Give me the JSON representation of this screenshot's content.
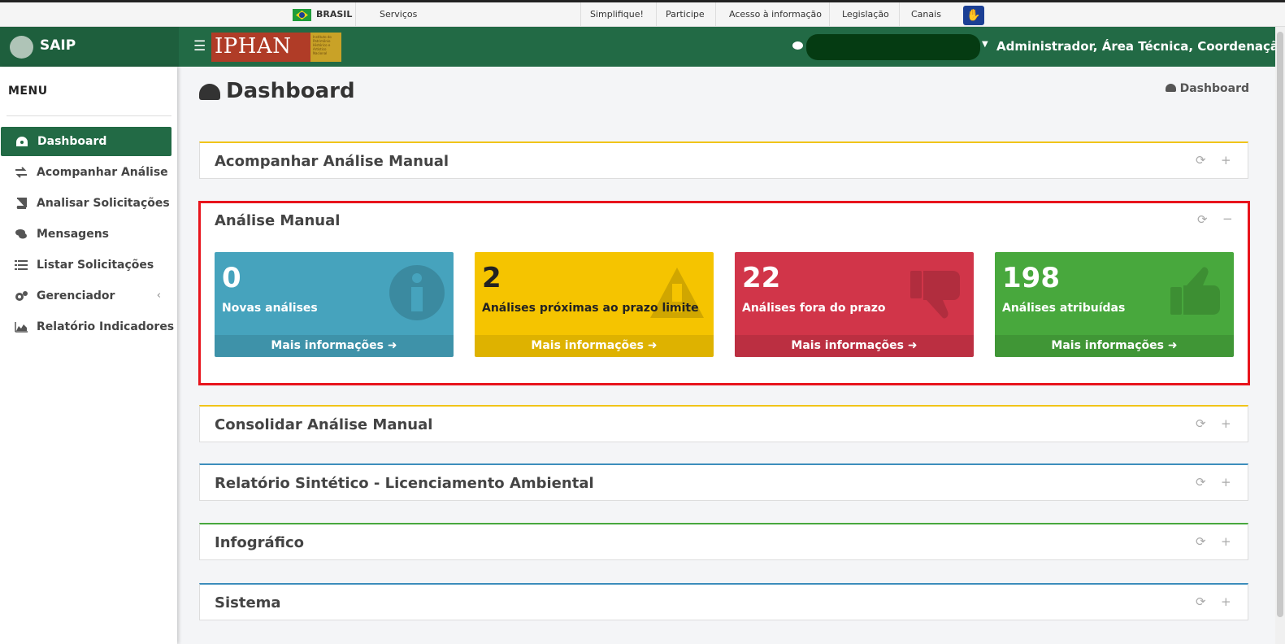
{
  "gov_bar": {
    "country": "BRASIL",
    "links": [
      "Serviços",
      "Simplifique!",
      "Participe",
      "Acesso à informação",
      "Legislação",
      "Canais"
    ]
  },
  "header": {
    "brand": "SAIP",
    "org_logo_text": "IPHAN",
    "org_logo_subtitle": "Instituto do Patrimônio Histórico e Artístico Nacional",
    "user_roles": "Administrador, Área Técnica, Coordenação..."
  },
  "sidebar": {
    "title": "MENU",
    "items": [
      {
        "label": "Dashboard",
        "icon": "dashboard-icon",
        "active": true
      },
      {
        "label": "Acompanhar Análise",
        "icon": "exchange-icon"
      },
      {
        "label": "Analisar Solicitações",
        "icon": "book-icon"
      },
      {
        "label": "Mensagens",
        "icon": "comments-icon"
      },
      {
        "label": "Listar Solicitações",
        "icon": "list-icon"
      },
      {
        "label": "Gerenciador",
        "icon": "gears-icon",
        "has_submenu": true
      },
      {
        "label": "Relatório Indicadores",
        "icon": "area-chart-icon"
      }
    ]
  },
  "page": {
    "title": "Dashboard",
    "breadcrumb": "Dashboard"
  },
  "boxes": [
    {
      "title": "Acompanhar Análise Manual",
      "accent": "#f0c419"
    },
    {
      "title": "Análise Manual"
    },
    {
      "title": "Consolidar Análise Manual",
      "accent": "#f0c419"
    },
    {
      "title": "Relatório Sintético - Licenciamento Ambiental",
      "accent": "#3c8dbc"
    },
    {
      "title": "Infográfico",
      "accent": "#48a83d"
    },
    {
      "title": "Sistema",
      "accent": "#3c8dbc"
    }
  ],
  "tiles": [
    {
      "value": "0",
      "label": "Novas análises",
      "footer": "Mais informações ➜",
      "color": "#46a3bd",
      "icon": "info-icon"
    },
    {
      "value": "2",
      "label": "Análises próximas ao prazo limite",
      "footer": "Mais informações ➜",
      "color": "#f5c400",
      "icon": "warning-icon"
    },
    {
      "value": "22",
      "label": "Análises fora do prazo",
      "footer": "Mais informações ➜",
      "color": "#d13549",
      "icon": "thumbs-down-icon"
    },
    {
      "value": "198",
      "label": "Análises atribuídas",
      "footer": "Mais informações ➜",
      "color": "#48a83d",
      "icon": "thumbs-up-icon"
    }
  ],
  "tools": {
    "refresh": "⟳",
    "expand": "+",
    "collapse": "−"
  }
}
